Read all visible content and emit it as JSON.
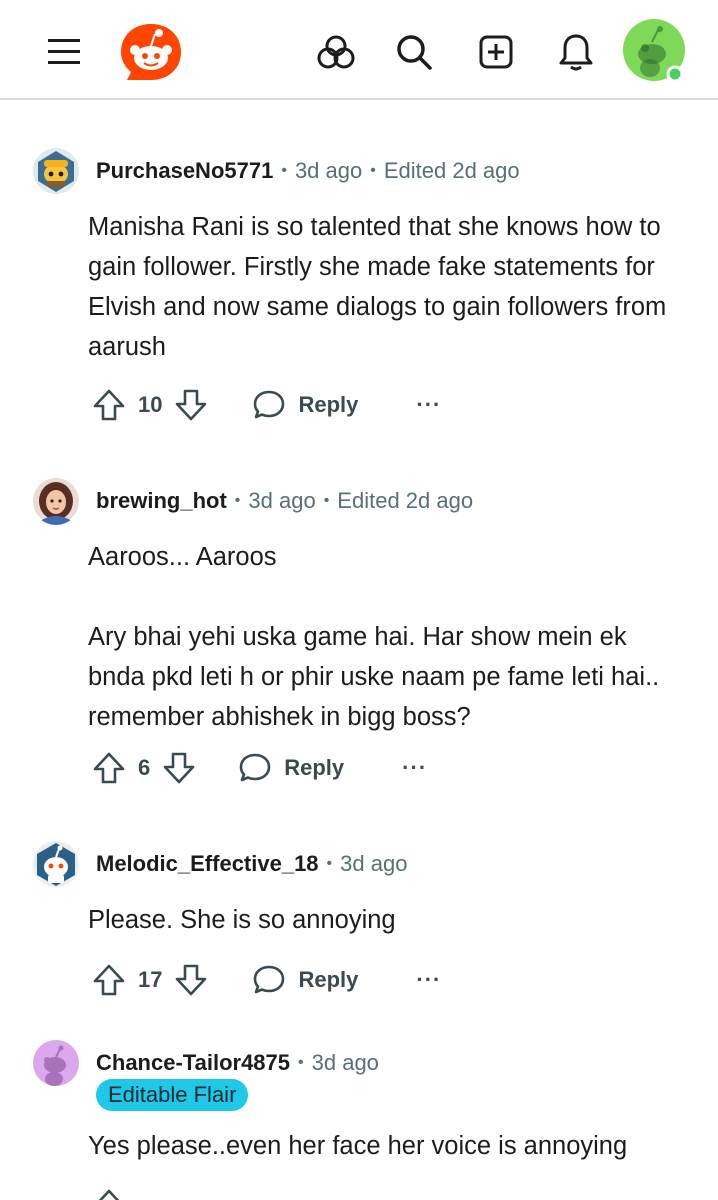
{
  "colors": {
    "brand": "#ff4500",
    "meta": "#576f76",
    "flair_bg": "#1ec8e6",
    "online": "#46d160",
    "avatar_me_bg": "#7ed957"
  },
  "topbar": {
    "icons": [
      "menu-icon",
      "reddit-logo",
      "explore-icon",
      "search-icon",
      "create-post-icon",
      "notifications-icon",
      "user-avatar"
    ]
  },
  "comments": [
    {
      "username": "PurchaseNo5771",
      "age": "3d ago",
      "edited": "Edited 2d ago",
      "body": [
        "Manisha Rani is so talented that she knows how to gain follower. Firstly she made fake statements for Elvish and now same dialogs to gain followers from aarush"
      ],
      "votes": "10",
      "reply_label": "Reply",
      "more_label": "···"
    },
    {
      "username": "brewing_hot",
      "age": "3d ago",
      "edited": "Edited 2d ago",
      "body": [
        "Aaroos... Aaroos",
        "Ary bhai yehi uska game hai. Har show mein ek bnda pkd leti h or phir uske naam pe fame leti hai.. remember abhishek in bigg boss?"
      ],
      "votes": "6",
      "reply_label": "Reply",
      "more_label": "···"
    },
    {
      "username": "Melodic_Effective_18",
      "age": "3d ago",
      "body": [
        "Please. She is so annoying"
      ],
      "votes": "17",
      "reply_label": "Reply",
      "more_label": "···"
    },
    {
      "username": "Chance-Tailor4875",
      "age": "3d ago",
      "flair": "Editable Flair",
      "body": [
        "Yes please..even her face her voice is annoying"
      ]
    }
  ]
}
